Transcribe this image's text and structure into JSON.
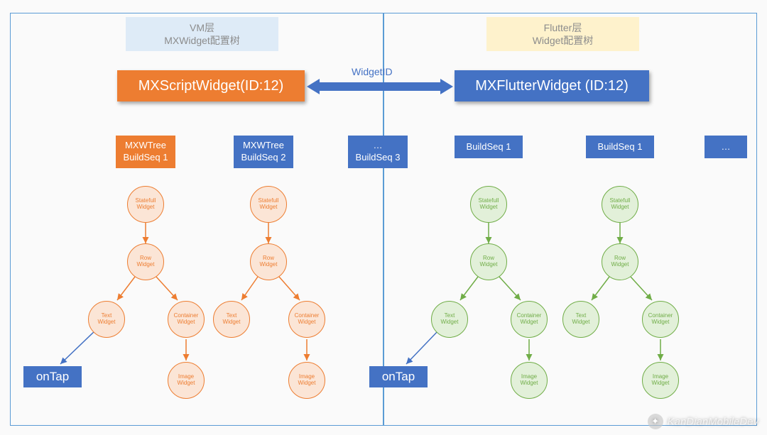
{
  "header_left_line1": "VM层",
  "header_left_line2": "MXWidget配置树",
  "header_right_line1": "Flutter层",
  "header_right_line2": "Widget配置树",
  "script_widget": "MXScriptWidget(ID:12)",
  "flutter_widget": "MXFlutterWidget (ID:12)",
  "arrow_label": "WidgetID",
  "seq": {
    "vm_seq1_l1": "MXWTree",
    "vm_seq1_l2": "BuildSeq 1",
    "vm_seq2_l1": "MXWTree",
    "vm_seq2_l2": "BuildSeq 2",
    "vm_seq3_l1": "…",
    "vm_seq3_l2": "BuildSeq 3",
    "fl_seq1": "BuildSeq 1",
    "fl_seq2": "BuildSeq 1",
    "fl_seq3": "…"
  },
  "nodes": {
    "statefull": "Statefull\nWidget",
    "row": "Row\nWidget",
    "text": "Text\nWidget",
    "container": "Container\nWidget",
    "image": "Image\nWidget"
  },
  "ontap": "onTap",
  "watermark": "KanDianMobileDev"
}
